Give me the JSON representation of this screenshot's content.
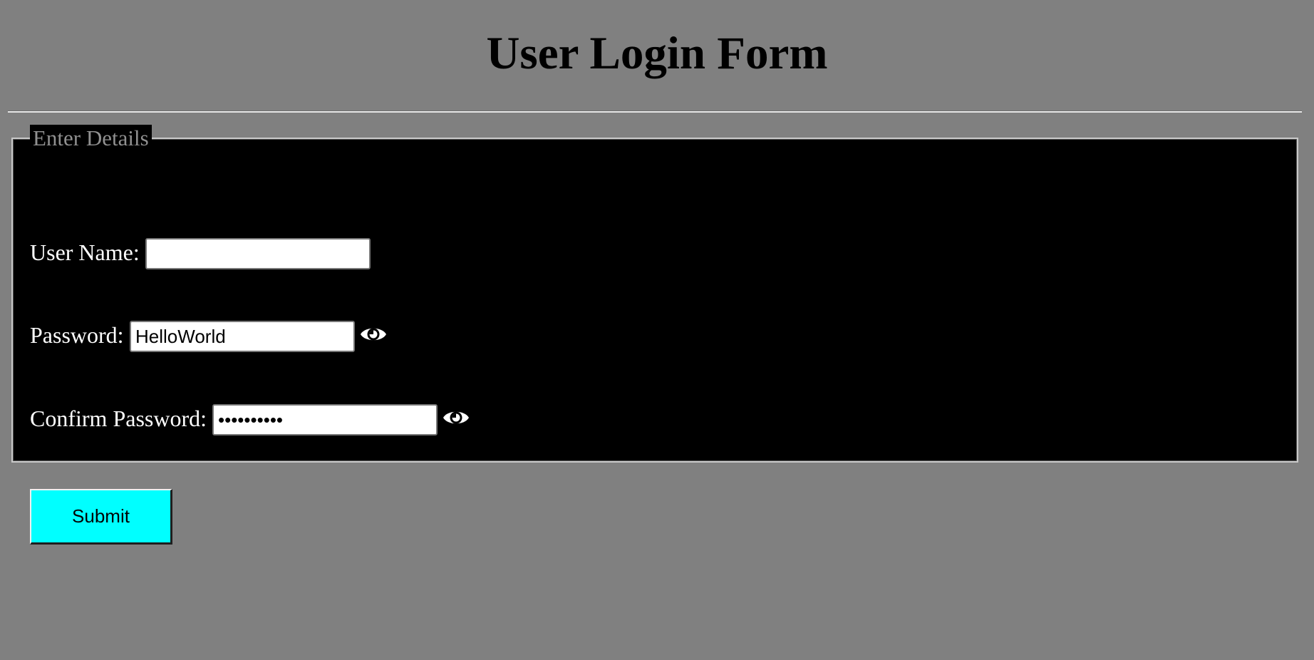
{
  "page": {
    "title": "User Login Form",
    "background_color": "#808080"
  },
  "form": {
    "legend": "Enter Details",
    "background_color": "#000000",
    "fields": {
      "username": {
        "label": "User Name:",
        "value": ""
      },
      "password": {
        "label": "Password:",
        "value": "HelloWorld",
        "visibility_icon": "eye-icon"
      },
      "confirm_password": {
        "label": "Confirm Password:",
        "masked_value": "••••••••••",
        "visibility_icon": "eye-icon"
      }
    },
    "submit_label": "Submit",
    "submit_color": "#00ffff"
  }
}
